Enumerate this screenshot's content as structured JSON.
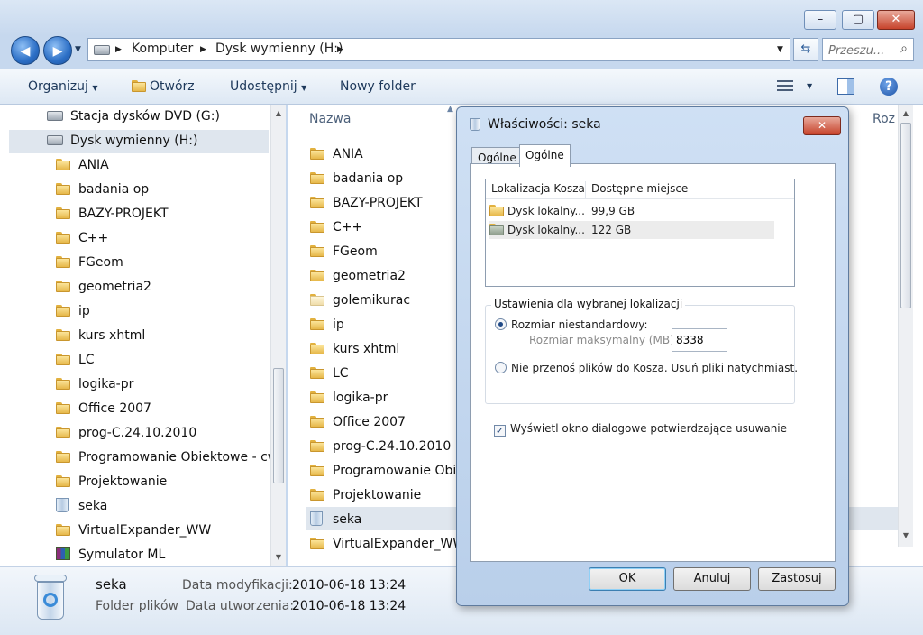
{
  "window": {
    "minimize": "–",
    "maximize": "▢",
    "close": "✕"
  },
  "nav": {
    "back": "◀",
    "forward": "▶"
  },
  "address": {
    "segments": [
      "Komputer",
      "Dysk wymienny (H:)"
    ],
    "separator": "▶"
  },
  "search": {
    "placeholder": "Przeszu..."
  },
  "toolbar": {
    "organize": "Organizuj",
    "open": "Otwórz",
    "share": "Udostępnij",
    "new_folder": "Nowy folder"
  },
  "sidebar": {
    "items": [
      {
        "label": "Stacja dysków DVD (G:)",
        "icon": "dvd-drive"
      },
      {
        "label": "Dysk wymienny (H:)",
        "icon": "removable-drive"
      },
      {
        "label": "ANIA",
        "icon": "folder"
      },
      {
        "label": "badania op",
        "icon": "folder"
      },
      {
        "label": "BAZY-PROJEKT",
        "icon": "folder"
      },
      {
        "label": "C++",
        "icon": "folder"
      },
      {
        "label": "FGeom",
        "icon": "folder"
      },
      {
        "label": "geometria2",
        "icon": "folder"
      },
      {
        "label": "ip",
        "icon": "folder"
      },
      {
        "label": "kurs xhtml",
        "icon": "folder"
      },
      {
        "label": "LC",
        "icon": "folder"
      },
      {
        "label": "logika-pr",
        "icon": "folder"
      },
      {
        "label": "Office 2007",
        "icon": "folder"
      },
      {
        "label": "prog-C.24.10.2010",
        "icon": "folder"
      },
      {
        "label": "Programowanie Obiektowe - cw",
        "icon": "folder"
      },
      {
        "label": "Projektowanie",
        "icon": "folder"
      },
      {
        "label": "seka",
        "icon": "recycle-bin"
      },
      {
        "label": "VirtualExpander_WW",
        "icon": "folder"
      },
      {
        "label": "Symulator ML",
        "icon": "rar-archive"
      }
    ]
  },
  "content": {
    "columns": {
      "name": "Nazwa",
      "size": "Roz"
    },
    "items": [
      {
        "label": "ANIA"
      },
      {
        "label": "badania op"
      },
      {
        "label": "BAZY-PROJEKT"
      },
      {
        "label": "C++"
      },
      {
        "label": "FGeom"
      },
      {
        "label": "geometria2"
      },
      {
        "label": "golemikurac"
      },
      {
        "label": "ip"
      },
      {
        "label": "kurs xhtml"
      },
      {
        "label": "LC"
      },
      {
        "label": "logika-pr"
      },
      {
        "label": "Office 2007"
      },
      {
        "label": "prog-C.24.10.2010"
      },
      {
        "label": "Programowanie Obie"
      },
      {
        "label": "Projektowanie"
      },
      {
        "label": "seka"
      },
      {
        "label": "VirtualExpander_WW"
      }
    ]
  },
  "details": {
    "name": "seka",
    "type": "Folder plików",
    "modified_label": "Data modyfikacji:",
    "modified_value": "2010-06-18 13:24",
    "created_label": "Data utworzenia:",
    "created_value": "2010-06-18 13:24"
  },
  "dialog": {
    "title": "Właściwości: seka",
    "close": "✕",
    "tabs": [
      "Ogólne",
      "Ogólne"
    ],
    "list": {
      "headers": [
        "Lokalizacja Kosza",
        "Dostępne miejsce"
      ],
      "rows": [
        {
          "location": "Dysk lokalny...",
          "space": "99,9 GB"
        },
        {
          "location": "Dysk lokalny...",
          "space": "122 GB"
        }
      ]
    },
    "settings_label": "Ustawienia dla wybranej lokalizacji",
    "custom_size_label": "Rozmiar niestandardowy:",
    "max_size_label": "Rozmiar maksymalny (MB):",
    "max_size_value": "8338",
    "no_move_label": "Nie przenoś plików do Kosza. Usuń pliki natychmiast.",
    "confirm_label": "Wyświetl okno dialogowe potwierdzające usuwanie",
    "buttons": {
      "ok": "OK",
      "cancel": "Anuluj",
      "apply": "Zastosuj"
    }
  },
  "colors": {
    "accent": "#2c6fc6",
    "selection": "#dfe6ee",
    "close": "#c7442c"
  }
}
